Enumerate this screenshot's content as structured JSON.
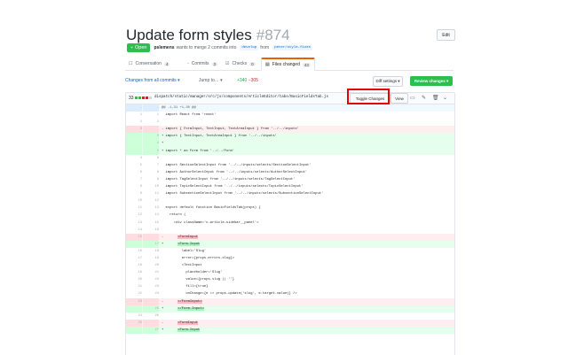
{
  "pr": {
    "title": "Update form styles",
    "number": "#874",
    "edit_label": "Edit",
    "status": "Open",
    "author": "pslemens",
    "summary_text": "wants to merge 2 commits into",
    "base_branch": "develop",
    "from_text": "from",
    "head_branch": "peter/style-fixes"
  },
  "tabs": [
    {
      "label": "Conversation",
      "count": "4"
    },
    {
      "label": "Commits",
      "count": "3"
    },
    {
      "label": "Checks",
      "count": "0"
    },
    {
      "label": "Files changed",
      "count": "43"
    }
  ],
  "toolbar": {
    "changes_from": "Changes from all commits ▾",
    "jump_to": "Jump to… ▾",
    "additions": "+340",
    "deletions": "−305",
    "diff_settings": "Diff settings ▾",
    "review_changes": "Review changes ▾"
  },
  "file": {
    "change_count": "33",
    "path": "dispatch/static/manager/src/js/components/ArticleEditor/tabs/BasicFieldsTab.js",
    "toggle_label": "Toggle Changes",
    "view_label": "View"
  },
  "diff_lines": [
    {
      "type": "hunk",
      "old": "…",
      "new": "…",
      "code": "@@ -1,31 +1,30 @@"
    },
    {
      "type": "ctx",
      "old": "1",
      "new": "1",
      "code": "  import React from 'react'"
    },
    {
      "type": "ctx",
      "old": "2",
      "new": "2",
      "code": ""
    },
    {
      "type": "del",
      "old": "3",
      "new": "",
      "code": "- import { FormInput, TextInput, TextAreaInput } from '../../inputs'"
    },
    {
      "type": "add",
      "old": "",
      "new": "3",
      "code": "+ import { TextInput, TextAreaInput } from '../../inputs'"
    },
    {
      "type": "add",
      "old": "",
      "new": "4",
      "code": "+"
    },
    {
      "type": "add",
      "old": "",
      "new": "5",
      "code": "+ import * as Form from '../../Form'"
    },
    {
      "type": "ctx",
      "old": "4",
      "new": "6",
      "code": ""
    },
    {
      "type": "ctx",
      "old": "5",
      "new": "7",
      "code": "  import SectionSelectInput from '../../inputs/selects/SectionSelectInput'"
    },
    {
      "type": "ctx",
      "old": "6",
      "new": "8",
      "code": "  import AuthorSelectInput from '../../inputs/selects/AuthorSelectInput'"
    },
    {
      "type": "ctx",
      "old": "7",
      "new": "9",
      "code": "  import TagSelectInput from '../../inputs/selects/TagSelectInput'"
    },
    {
      "type": "ctx",
      "old": "8",
      "new": "10",
      "code": "  import TopicSelectInput from '../../inputs/selects/TopicSelectInput'"
    },
    {
      "type": "ctx",
      "old": "9",
      "new": "11",
      "code": "  import SubsectionSelectInput from '../../inputs/selects/SubsectionSelectInput'"
    },
    {
      "type": "ctx",
      "old": "10",
      "new": "12",
      "code": ""
    },
    {
      "type": "ctx",
      "old": "11",
      "new": "13",
      "code": "  export default function BasicFieldsTab(props) {"
    },
    {
      "type": "ctx",
      "old": "12",
      "new": "14",
      "code": "    return ("
    },
    {
      "type": "ctx",
      "old": "13",
      "new": "15",
      "code": "      <div className='c-article-sidebar__panel'>"
    },
    {
      "type": "ctx",
      "old": "14",
      "new": "16",
      "code": ""
    },
    {
      "type": "del",
      "old": "15",
      "new": "",
      "code": "-       <FormInput",
      "mark": "<FormInput"
    },
    {
      "type": "add",
      "old": "",
      "new": "17",
      "code": "+       <Form.Input",
      "mark": "<Form.Input"
    },
    {
      "type": "ctx",
      "old": "16",
      "new": "18",
      "code": "          label='Slug'"
    },
    {
      "type": "ctx",
      "old": "17",
      "new": "19",
      "code": "          error={props.errors.slug}>"
    },
    {
      "type": "ctx",
      "old": "18",
      "new": "20",
      "code": "          <TextInput"
    },
    {
      "type": "ctx",
      "old": "19",
      "new": "21",
      "code": "            placeholder='Slug'"
    },
    {
      "type": "ctx",
      "old": "20",
      "new": "22",
      "code": "            value={props.slug || ''}"
    },
    {
      "type": "ctx",
      "old": "21",
      "new": "23",
      "code": "            fill={true}"
    },
    {
      "type": "ctx",
      "old": "22",
      "new": "24",
      "code": "            onChange={e => props.update('slug', e.target.value)} />"
    },
    {
      "type": "del",
      "old": "23",
      "new": "",
      "code": "-       </FormInput>",
      "mark": "</FormInput>"
    },
    {
      "type": "add",
      "old": "",
      "new": "25",
      "code": "+       </Form.Input>",
      "mark": "</Form.Input>"
    },
    {
      "type": "ctx",
      "old": "24",
      "new": "26",
      "code": ""
    },
    {
      "type": "del",
      "old": "25",
      "new": "",
      "code": "-       <FormInput",
      "mark": "<FormInput"
    },
    {
      "type": "add",
      "old": "",
      "new": "27",
      "code": "+       <Form.Input",
      "mark": "<Form.Input"
    }
  ]
}
